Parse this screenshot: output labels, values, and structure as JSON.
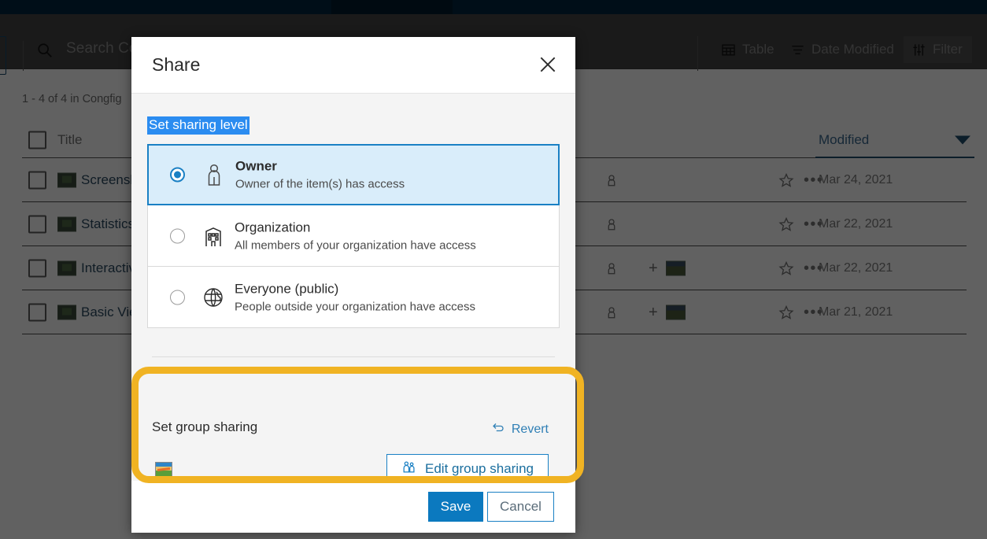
{
  "app": {
    "search": {
      "placeholder": "Search Configurable Apps",
      "icon": "search-icon"
    },
    "toolbar": {
      "table_label": "Table",
      "date_modified_label": "Date Modified",
      "filter_label": "Filter"
    },
    "results_count": "1 - 4 of 4 in Congfig",
    "table": {
      "columns": [
        "Title",
        "Modified"
      ],
      "rows": [
        {
          "title": "Screensho",
          "modified": "Mar 24, 2021",
          "has_group": false
        },
        {
          "title": "Statistics (",
          "modified": "Mar 22, 2021",
          "has_group": false
        },
        {
          "title": "Interactive",
          "modified": "Mar 22, 2021",
          "has_group": true
        },
        {
          "title": "Basic View",
          "modified": "Mar 21, 2021",
          "has_group": true
        }
      ]
    }
  },
  "modal": {
    "title": "Share",
    "close_label": "×",
    "section_label": "Set sharing level",
    "options": [
      {
        "id": "owner",
        "title": "Owner",
        "description": "Owner of the item(s) has access",
        "icon": "person-icon",
        "selected": true
      },
      {
        "id": "organization",
        "title": "Organization",
        "description": "All members of your organization have access",
        "icon": "building-icon",
        "selected": false
      },
      {
        "id": "everyone",
        "title": "Everyone (public)",
        "description": "People outside your organization have access",
        "icon": "globe-icon",
        "selected": false
      }
    ],
    "group_sharing": {
      "title": "Set group sharing",
      "revert_label": "Revert",
      "revert_icon": "undo-arrow-icon",
      "edit_button_label": "Edit group sharing",
      "edit_button_icon": "group-people-icon",
      "group_thumbnail": "map-thumbnail"
    },
    "footer": {
      "save_label": "Save",
      "cancel_label": "Cancel"
    }
  },
  "colors": {
    "accent_blue": "#0b79bf",
    "highlight_yellow": "#f0b323",
    "selection_blue": "#2b8cf0",
    "topbar_navy": "#00253f"
  }
}
